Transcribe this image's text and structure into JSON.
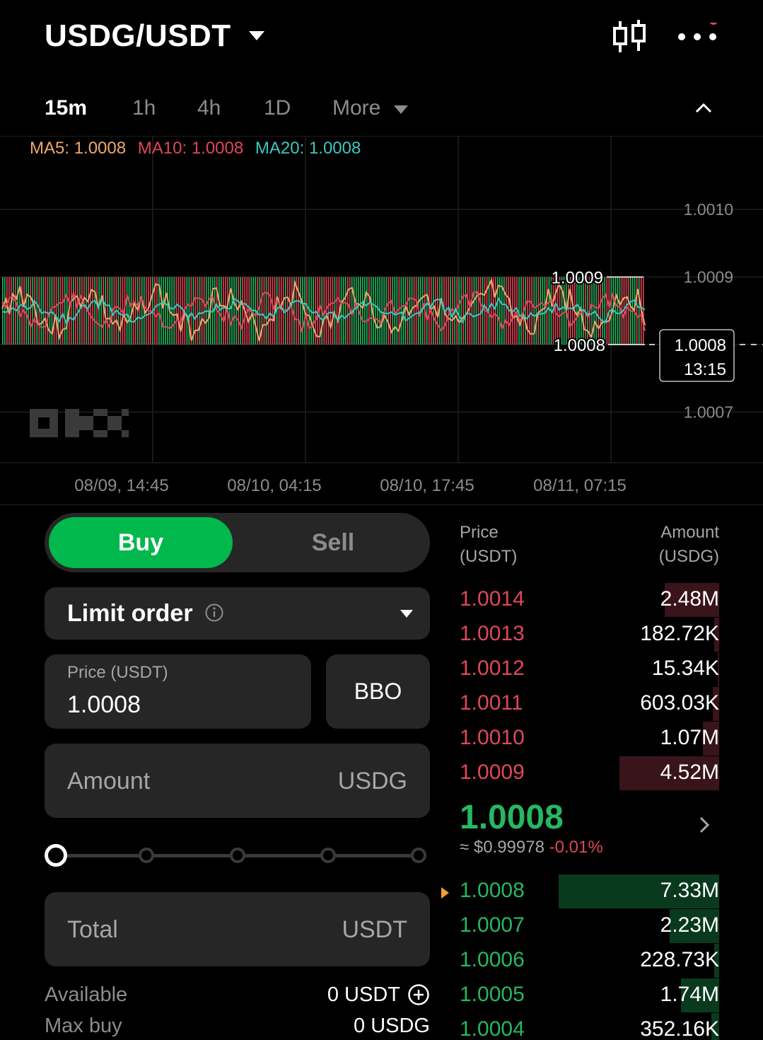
{
  "header": {
    "pair": "USDG/USDT",
    "dropdown_icon": "chevron-down-icon",
    "chart_type_icon": "candlestick-icon",
    "more_icon": "more-dots-icon",
    "notification_dot_color": "#e0475a"
  },
  "timeframes": {
    "items": [
      "15m",
      "1h",
      "4h",
      "1D",
      "More"
    ],
    "active": "15m",
    "collapse_icon": "chevron-up-icon"
  },
  "chart": {
    "ma": {
      "ma5_label": "MA5:",
      "ma5_value": "1.0008",
      "ma10_label": "MA10:",
      "ma10_value": "1.0008",
      "ma20_label": "MA20:",
      "ma20_value": "1.0008"
    },
    "colors": {
      "ma5": "#f0a86a",
      "ma10": "#e0475a",
      "ma20": "#3cc8c0",
      "up": "#25b862",
      "down": "#e0475a"
    },
    "high_label": "1.0009",
    "low_label": "1.0008",
    "current_price": "1.0008",
    "current_time": "13:15",
    "watermark": "OKX"
  },
  "chart_data": {
    "type": "candlestick",
    "x_tick_labels": [
      "08/09, 14:45",
      "08/10, 04:15",
      "08/10, 17:45",
      "08/11, 07:15"
    ],
    "y_tick_labels": [
      "1.0010",
      "1.0009",
      "1.0008",
      "1.0007"
    ],
    "ylim": [
      1.00065,
      1.00105
    ],
    "high": 1.0009,
    "low": 1.0008,
    "last": 1.0008,
    "series": [
      {
        "name": "MA5",
        "value": 1.0008
      },
      {
        "name": "MA10",
        "value": 1.0008
      },
      {
        "name": "MA20",
        "value": 1.0008
      }
    ],
    "grid": true
  },
  "trade": {
    "buy_label": "Buy",
    "sell_label": "Sell",
    "order_type": "Limit order",
    "info_icon": "info-icon",
    "price_label": "Price (USDT)",
    "price_value": "1.0008",
    "bbo_label": "BBO",
    "amount_placeholder": "Amount",
    "amount_unit": "USDG",
    "slider_percent": 0,
    "total_placeholder": "Total",
    "total_unit": "USDT",
    "available_label": "Available",
    "available_value": "0 USDT",
    "max_buy_label": "Max buy",
    "max_buy_value": "0 USDG"
  },
  "orderbook": {
    "price_header_1": "Price",
    "price_header_2": "(USDT)",
    "amount_header_1": "Amount",
    "amount_header_2": "(USDG)",
    "asks": [
      {
        "price": "1.0014",
        "amount": "2.48M",
        "depth": 0.34
      },
      {
        "price": "1.0013",
        "amount": "182.72K",
        "depth": 0.03
      },
      {
        "price": "1.0012",
        "amount": "15.34K",
        "depth": 0.01
      },
      {
        "price": "1.0011",
        "amount": "603.03K",
        "depth": 0.04
      },
      {
        "price": "1.0010",
        "amount": "1.07M",
        "depth": 0.1
      },
      {
        "price": "1.0009",
        "amount": "4.52M",
        "depth": 0.62
      }
    ],
    "mid_price": "1.0008",
    "mid_usd": "≈ $0.99978",
    "mid_change": "-0.01%",
    "bids": [
      {
        "price": "1.0008",
        "amount": "7.33M",
        "depth": 1.0
      },
      {
        "price": "1.0007",
        "amount": "2.23M",
        "depth": 0.31
      },
      {
        "price": "1.0006",
        "amount": "228.73K",
        "depth": 0.03
      },
      {
        "price": "1.0005",
        "amount": "1.74M",
        "depth": 0.24
      },
      {
        "price": "1.0004",
        "amount": "352.16K",
        "depth": 0.05
      }
    ]
  }
}
